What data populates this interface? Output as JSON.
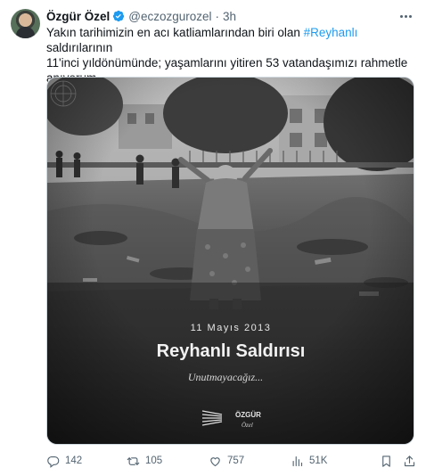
{
  "author": {
    "name": "Özgür Özel",
    "handle": "@eczozgurozel",
    "separator": "·",
    "time": "3h"
  },
  "tweet": {
    "text_part1": "Yakın tarihimizin en acı katliamlarından biri olan ",
    "hashtag": "#Reyhanlı",
    "text_part2_line1": " saldırılarının",
    "text_line2": "11'inci yıldönümünde; yaşamlarını yitiren 53 vatandaşımızı rahmetle",
    "text_line3": "anıyorum."
  },
  "media": {
    "date": "11 Mayıs 2013",
    "title": "Reyhanlı Saldırısı",
    "signature": "Unutmayacağız...",
    "logo_word": "ÖZGÜR",
    "logo_script": "Özel"
  },
  "actions": {
    "replies": "142",
    "reposts": "105",
    "likes": "757",
    "views": "51K"
  },
  "colors": {
    "accent": "#1d9bf0",
    "secondary_text": "#536471",
    "primary_text": "#0f1419"
  },
  "icons": [
    "verified-badge-icon",
    "more-icon",
    "reply-icon",
    "repost-icon",
    "like-icon",
    "views-icon",
    "bookmark-icon",
    "share-icon"
  ]
}
